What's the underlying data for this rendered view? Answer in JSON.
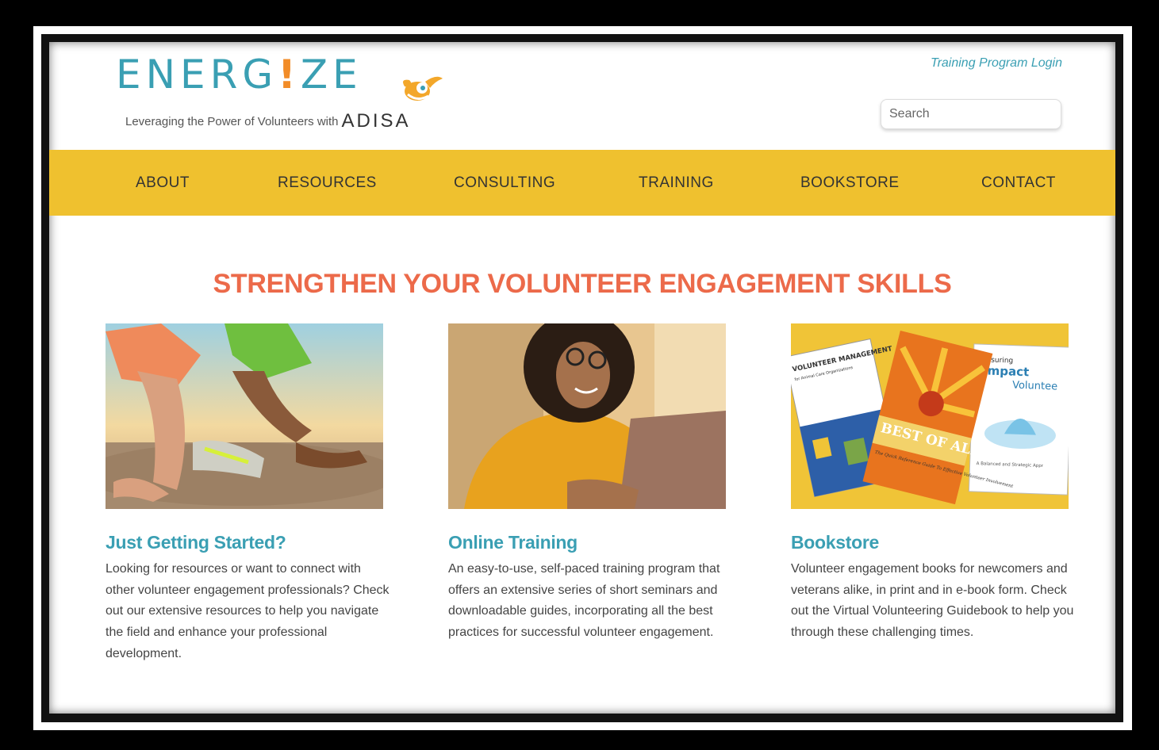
{
  "logo": {
    "word_left": "ENERG",
    "word_bang": "!",
    "word_right": "ZE",
    "tagline": "Leveraging the Power of Volunteers with",
    "brand": "ADISA"
  },
  "header": {
    "login_link": "Training Program Login",
    "search_placeholder": "Search"
  },
  "nav": {
    "items": [
      "ABOUT",
      "RESOURCES",
      "CONSULTING",
      "TRAINING",
      "BOOKSTORE",
      "CONTACT"
    ]
  },
  "headline": "STRENGTHEN YOUR VOLUNTEER ENGAGEMENT SKILLS",
  "cards": [
    {
      "title": "Just Getting Started?",
      "text": "Looking for resources or want to connect with other volunteer engagement professionals? Check out our extensive resources to help you navigate the field and enhance your professional development.",
      "image": "runners-starting-line-photo"
    },
    {
      "title": "Online Training",
      "text": "An easy-to-use, self-paced training program that offers an extensive series of short seminars and downloadable guides, incorporating all the best practices for successful volunteer engagement.",
      "image": "woman-with-laptop-photo"
    },
    {
      "title": "Bookstore",
      "text": "Volunteer engagement books for newcomers and veterans alike, in print and in e-book form. Check out the Virtual Volunteering Guidebook to help you through these challenging times.",
      "image": "book-covers-photo",
      "books": {
        "book1_title": "VOLUNTEER MANAGEMENT",
        "book1_sub": "for Animal Care Organizations",
        "book2_title": "BEST OF ALL",
        "book2_sub": "The Quick Reference Guide To Effective Volunteer Involvement",
        "book3_top": "suring",
        "book3_title": "mpact",
        "book3_sub": "Voluntee",
        "book3_note": "A Balanced and Strategic Appr"
      }
    }
  ],
  "colors": {
    "nav_bg": "#efc12f",
    "headline": "#ec6a4a",
    "link": "#3a9fb3",
    "logo_bang": "#f28c28"
  }
}
